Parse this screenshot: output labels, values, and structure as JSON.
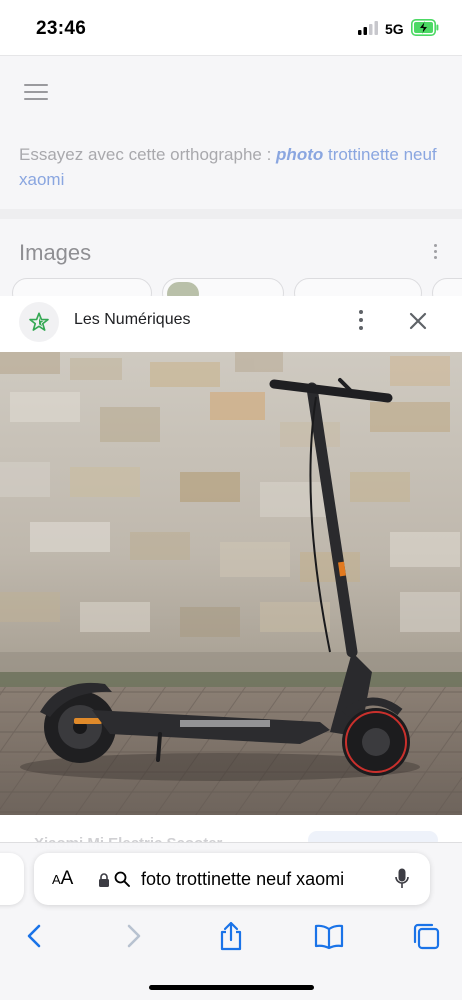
{
  "status_bar": {
    "time": "23:46",
    "network": "5G",
    "battery": "charging"
  },
  "google_page": {
    "suggestion_prefix": "Essayez avec cette orthographe : ",
    "suggestion_bold": "photo",
    "suggestion_rest": " trottinette neuf xaomi",
    "images_section_title": "Images"
  },
  "viewer": {
    "source_name": "Les Numériques",
    "logo_icon": "green-star-icon",
    "image_subject": "trottinette électrique Xiaomi noire devant un mur de pierre",
    "title_partial": "Xiaomi Mi Electric Scooter"
  },
  "browser": {
    "text_size_label_small": "A",
    "text_size_label_large": "A",
    "address": "foto trottinette neuf xaomi",
    "toolbar": [
      "back-icon",
      "forward-icon",
      "share-icon",
      "bookmarks-icon",
      "tabs-icon"
    ]
  },
  "colors": {
    "accent": "#1a73e8",
    "suggestion_link": "#8aa6e0",
    "star_green": "#34a853"
  }
}
